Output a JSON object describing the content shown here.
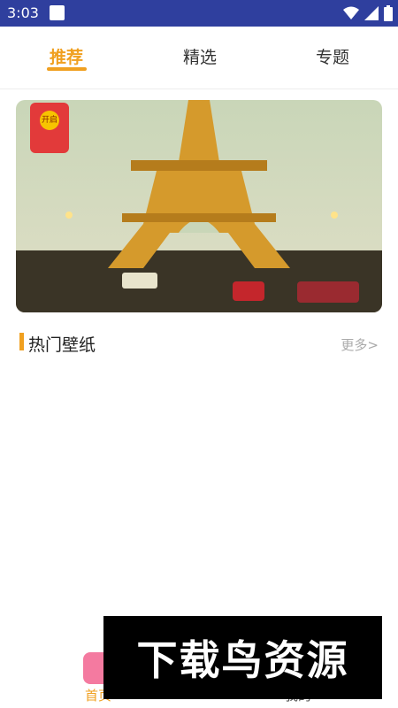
{
  "status": {
    "time": "3:03"
  },
  "tabs": [
    {
      "label": "推荐",
      "active": true
    },
    {
      "label": "精选",
      "active": false
    },
    {
      "label": "专题",
      "active": false
    }
  ],
  "banner": {
    "badge_text": "开启"
  },
  "section": {
    "title": "热门壁纸",
    "more": "更多>"
  },
  "bottom_nav": {
    "home": "首页",
    "mine": "我的"
  },
  "watermark": "下载鸟资源",
  "colors": {
    "accent": "#f0a020",
    "status_bar": "#2f3f9e"
  }
}
